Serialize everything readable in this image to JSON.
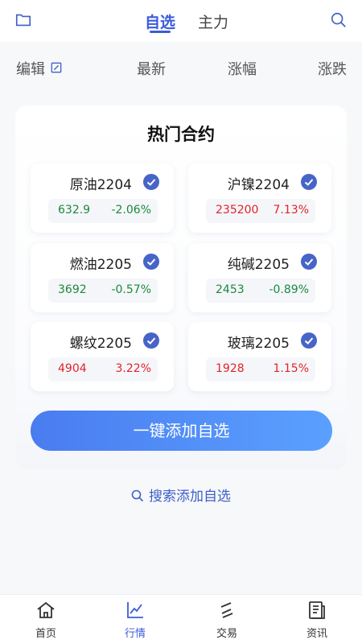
{
  "header": {
    "tabs": [
      {
        "label": "自选",
        "active": true
      },
      {
        "label": "主力",
        "active": false
      }
    ],
    "left_icon": "folder-icon",
    "right_icon": "search-icon"
  },
  "columns": {
    "edit": "编辑",
    "latest": "最新",
    "change": "涨幅",
    "diff": "涨跌"
  },
  "hot": {
    "title": "热门合约",
    "contracts": [
      {
        "name": "原油2204",
        "price": "632.9",
        "pct": "-2.06%",
        "color": "#1a8a3c"
      },
      {
        "name": "沪镍2204",
        "price": "235200",
        "pct": "7.13%",
        "color": "#e0242b"
      },
      {
        "name": "燃油2205",
        "price": "3692",
        "pct": "-0.57%",
        "color": "#1a8a3c"
      },
      {
        "name": "纯碱2205",
        "price": "2453",
        "pct": "-0.89%",
        "color": "#1a8a3c"
      },
      {
        "name": "螺纹2205",
        "price": "4904",
        "pct": "3.22%",
        "color": "#e0242b"
      },
      {
        "name": "玻璃2205",
        "price": "1928",
        "pct": "1.15%",
        "color": "#e0242b"
      }
    ],
    "add_button": "一键添加自选",
    "search_link": "搜索添加自选"
  },
  "bottom_nav": [
    {
      "label": "首页",
      "icon": "home-icon"
    },
    {
      "label": "行情",
      "icon": "chart-icon",
      "active": true
    },
    {
      "label": "交易",
      "icon": "trade-icon"
    },
    {
      "label": "资讯",
      "icon": "news-icon"
    }
  ],
  "colors": {
    "accent": "#3b5bdb",
    "up": "#e0242b",
    "down": "#1a8a3c"
  }
}
